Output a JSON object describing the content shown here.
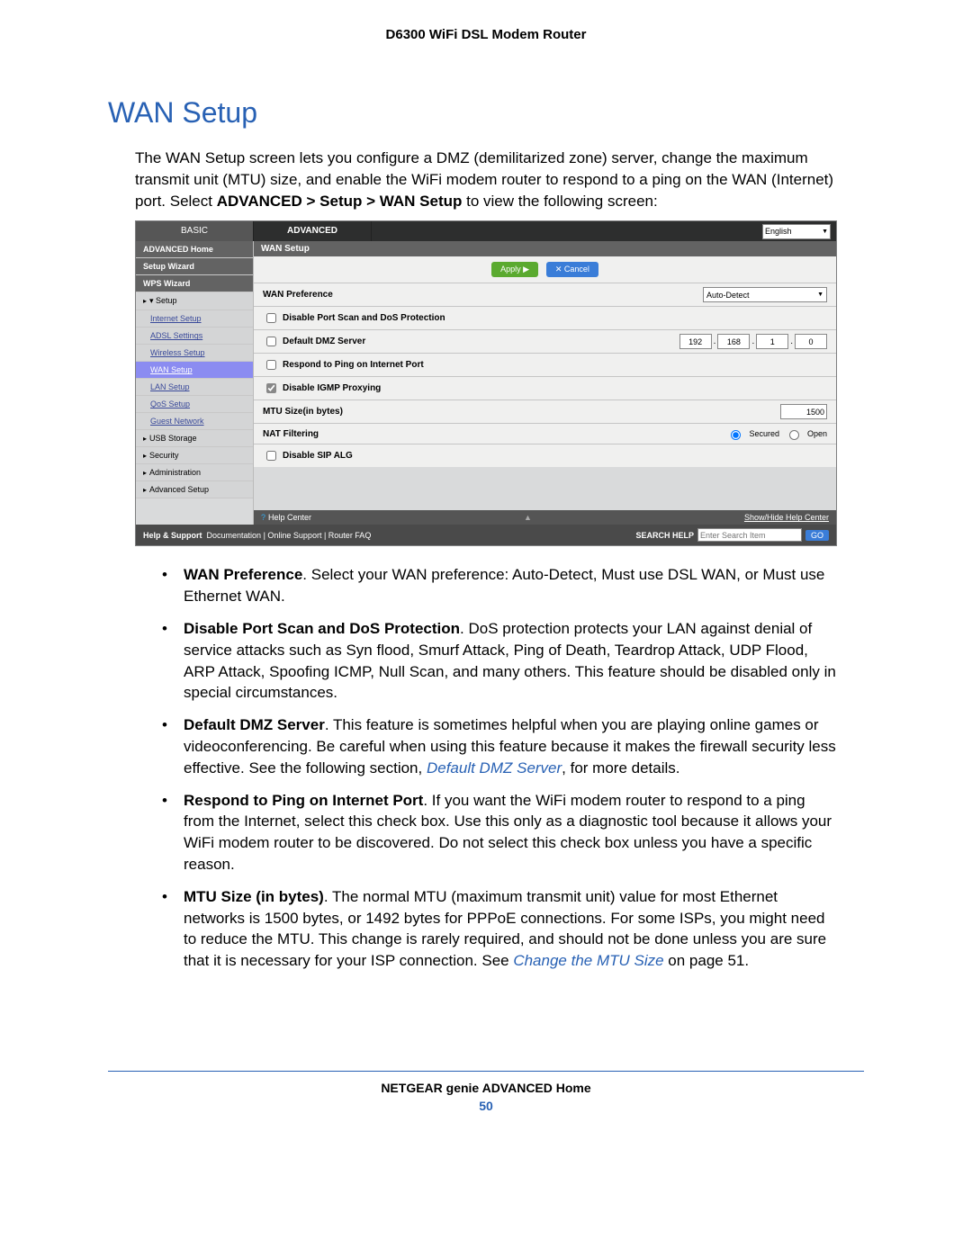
{
  "doc": {
    "header": "D6300 WiFi DSL Modem Router",
    "title": "WAN Setup",
    "intro_pre": "The WAN Setup screen lets you configure a DMZ (demilitarized zone) server, change the maximum transmit unit (MTU) size, and enable the WiFi modem router to respond to a ping on the WAN (Internet) port. Select ",
    "intro_bold": "ADVANCED > Setup > WAN Setup",
    "intro_post": " to view the following screen:"
  },
  "shot": {
    "tabs": {
      "basic": "BASIC",
      "advanced": "ADVANCED"
    },
    "language": "English",
    "sidebar": {
      "advanced_home": "ADVANCED Home",
      "setup_wizard": "Setup Wizard",
      "wps_wizard": "WPS Wizard",
      "setup": "Setup",
      "internet_setup": "Internet Setup",
      "adsl_settings": "ADSL Settings",
      "wireless_setup": "Wireless Setup",
      "wan_setup": "WAN Setup",
      "lan_setup": "LAN Setup",
      "qos_setup": "QoS Setup",
      "guest_network": "Guest Network",
      "usb_storage": "USB Storage",
      "security": "Security",
      "administration": "Administration",
      "advanced_setup": "Advanced Setup"
    },
    "panel": {
      "title": "WAN Setup",
      "apply": "Apply ▶",
      "cancel": "✕ Cancel",
      "wan_pref_label": "WAN Preference",
      "wan_pref_value": "Auto-Detect",
      "disable_port_scan": "Disable Port Scan and DoS Protection",
      "default_dmz": "Default DMZ Server",
      "dmz_ip": {
        "a": "192",
        "b": "168",
        "c": "1",
        "d": "0"
      },
      "respond_ping": "Respond to Ping on Internet Port",
      "disable_igmp": "Disable IGMP Proxying",
      "mtu_label": "MTU Size(in bytes)",
      "mtu_value": "1500",
      "nat_label": "NAT Filtering",
      "nat_secured": "Secured",
      "nat_open": "Open",
      "disable_sip": "Disable SIP ALG"
    },
    "helpbar": {
      "help_center": "Help Center",
      "show_hide": "Show/Hide Help Center"
    },
    "hs": {
      "label": "Help & Support",
      "doc": "Documentation",
      "support": "Online Support",
      "faq": "Router FAQ",
      "search_label": "SEARCH HELP",
      "search_ph": "Enter Search Item",
      "go": "GO"
    }
  },
  "bullets": {
    "b1_bold": "WAN Preference",
    "b1_text": ". Select your WAN preference: Auto-Detect, Must use DSL WAN, or Must use Ethernet WAN.",
    "b2_bold": "Disable Port Scan and DoS Protection",
    "b2_text": ". DoS protection protects your LAN against denial of service attacks such as Syn flood, Smurf Attack, Ping of Death, Teardrop Attack, UDP Flood, ARP Attack, Spoofing ICMP, Null Scan, and many others. This feature should be disabled only in special circumstances.",
    "b3_bold": "Default DMZ Server",
    "b3_text_a": ". This feature is sometimes helpful when you are playing online games or videoconferencing. Be careful when using this feature because it makes the firewall security less effective. See the following section, ",
    "b3_link": "Default DMZ Server",
    "b3_text_b": ", for more details.",
    "b4_bold": "Respond to Ping on Internet Port",
    "b4_text": ". If you want the WiFi modem router to respond to a ping from the Internet, select this check box. Use this only as a diagnostic tool because it allows your WiFi modem router to be discovered. Do not select this check box unless you have a specific reason.",
    "b5_bold": "MTU Size (in bytes)",
    "b5_text_a": ". The normal MTU (maximum transmit unit) value for most Ethernet networks is 1500 bytes, or 1492 bytes for PPPoE connections. For some ISPs, you might need to reduce the MTU. This change is rarely required, and should not be done unless you are sure that it is necessary for your ISP connection. See ",
    "b5_link": "Change the MTU Size",
    "b5_text_b": " on page 51."
  },
  "footer": {
    "line1": "NETGEAR genie ADVANCED Home",
    "page": "50"
  }
}
